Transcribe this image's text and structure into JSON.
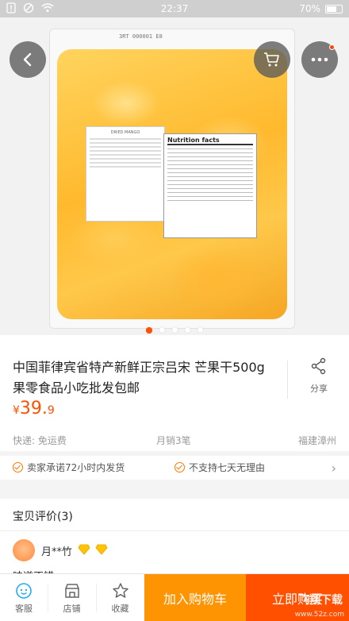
{
  "status_bar": {
    "time": "22:37",
    "battery_text": "70%",
    "battery_level": 0.7
  },
  "nav": {
    "back_icon": "chevron-left-icon",
    "cart_icon": "cart-icon",
    "more_icon": "more-dots-icon",
    "more_has_badge": true
  },
  "product_image": {
    "bag_code": "3RT 000001 E8",
    "label_heading": "DRIED MANGO",
    "nutrition_title": "Nutrition facts",
    "carousel_count": 5,
    "carousel_active": 0
  },
  "product": {
    "title": "中国菲律宾省特产新鲜正宗吕宋 芒果干500g 果零食品小吃批发包邮",
    "share_label": "分享",
    "price_currency": "¥",
    "price_main": "39.",
    "price_decimal": "9"
  },
  "meta": {
    "shipping": "快递: 免运费",
    "monthly_sales": "月销3笔",
    "location": "福建漳州"
  },
  "promises": [
    "卖家承诺72小时内发货",
    "不支持七天无理由"
  ],
  "reviews": {
    "title": "宝贝评价(3)",
    "reviewer_name": "月**竹",
    "first_review": "味道不错"
  },
  "bottom_bar": {
    "service_label": "客服",
    "shop_label": "店铺",
    "favorite_label": "收藏",
    "add_to_cart": "加入购物车",
    "buy_now": "立即购买"
  },
  "watermark": {
    "logo": "飞翔下载",
    "url": "www.52z.com"
  },
  "colors": {
    "accent": "#ff5000",
    "cart_orange": "#ff9402",
    "promise_icon": "#ff7700"
  }
}
